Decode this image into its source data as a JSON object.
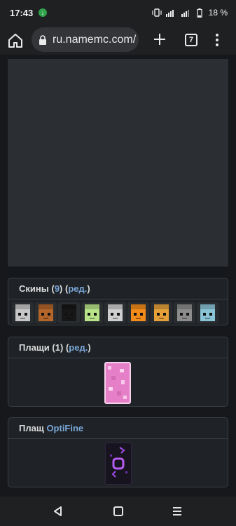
{
  "status_bar": {
    "time": "17:43",
    "battery": "18 %"
  },
  "browser": {
    "url": "ru.namemc.com/",
    "tab_count": "7"
  },
  "skins_card": {
    "label": "Скины",
    "count": "9",
    "edit": "ред.",
    "thumbnails": [
      {
        "theme": "white-hair",
        "color": "#c7c7c7"
      },
      {
        "theme": "fox",
        "color": "#b4652a"
      },
      {
        "theme": "dark-horns",
        "color": "#171717"
      },
      {
        "theme": "lime",
        "color": "#b8e388"
      },
      {
        "theme": "white-hair-2",
        "color": "#cfcfcf"
      },
      {
        "theme": "orange-black",
        "color": "#f28b1a"
      },
      {
        "theme": "orange-ears",
        "color": "#e5a03a"
      },
      {
        "theme": "grey-hair",
        "color": "#8c8c8c"
      },
      {
        "theme": "cyan-hair",
        "color": "#89c3d6"
      }
    ]
  },
  "capes_card": {
    "label": "Плащи",
    "count_text": "(1)",
    "edit": "ред."
  },
  "optifine_card": {
    "label": "Плащ",
    "brand": "OptiFine"
  },
  "colors": {
    "accent_link": "#79a6d6",
    "pink_cape": "#e57fc8",
    "optifine_purple": "#a04be8"
  }
}
